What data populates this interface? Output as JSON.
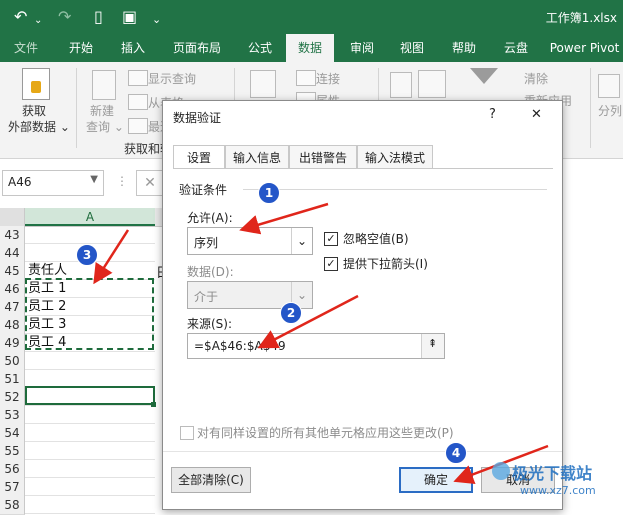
{
  "titlebar": {
    "doc_title": "工作簿1.xlsx"
  },
  "tabs": [
    "文件",
    "开始",
    "插入",
    "页面布局",
    "公式",
    "数据",
    "审阅",
    "视图",
    "帮助",
    "云盘",
    "Power Pivot"
  ],
  "ribbon": {
    "get_data": [
      "获取",
      "外部数据 ⌄"
    ],
    "new_query": [
      "新建",
      "查询 ⌄"
    ],
    "show_queries": "显示查询",
    "from_table": "从表格",
    "recent_sources": "最近使",
    "group_label": "获取和转",
    "connections": "连接",
    "properties": "属性",
    "clear": "清除",
    "reapply": "重新应用",
    "split": "分列"
  },
  "namebox": {
    "value": "A46"
  },
  "sheet": {
    "col_label": "A",
    "rows": [
      {
        "num": "43",
        "a": ""
      },
      {
        "num": "44",
        "a": ""
      },
      {
        "num": "45",
        "a": "责任人"
      },
      {
        "num": "46",
        "a": "员工 1"
      },
      {
        "num": "47",
        "a": "员工 2"
      },
      {
        "num": "48",
        "a": "员工 3"
      },
      {
        "num": "49",
        "a": "员工 4"
      },
      {
        "num": "50",
        "a": ""
      },
      {
        "num": "51",
        "a": ""
      },
      {
        "num": "52",
        "a": ""
      },
      {
        "num": "53",
        "a": ""
      },
      {
        "num": "54",
        "a": ""
      },
      {
        "num": "55",
        "a": ""
      },
      {
        "num": "56",
        "a": ""
      },
      {
        "num": "57",
        "a": ""
      },
      {
        "num": "58",
        "a": ""
      }
    ],
    "edge_char": "日"
  },
  "dialog": {
    "title": "数据验证",
    "help": "?",
    "close": "✕",
    "tabs": [
      "设置",
      "输入信息",
      "出错警告",
      "输入法模式"
    ],
    "section": "验证条件",
    "allow_label": "允许(A):",
    "allow_value": "序列",
    "ignore_blank": "忽略空值(B)",
    "dropdown": "提供下拉箭头(I)",
    "data_label": "数据(D):",
    "data_value": "介于",
    "source_label": "来源(S):",
    "source_value": "=$A$46:$A$49",
    "apply_all": "对有同样设置的所有其他单元格应用这些更改(P)",
    "clear_all": "全部清除(C)",
    "ok": "确定",
    "cancel": "取消"
  },
  "badges": [
    "1",
    "2",
    "3",
    "4"
  ],
  "watermark": {
    "name": "极光下载站",
    "url": "www.xz7.com"
  },
  "colors": {
    "excel_green": "#217346",
    "badge_blue": "#2456c8",
    "arrow_red": "#e0261b",
    "selection": "#1e6b3c"
  }
}
